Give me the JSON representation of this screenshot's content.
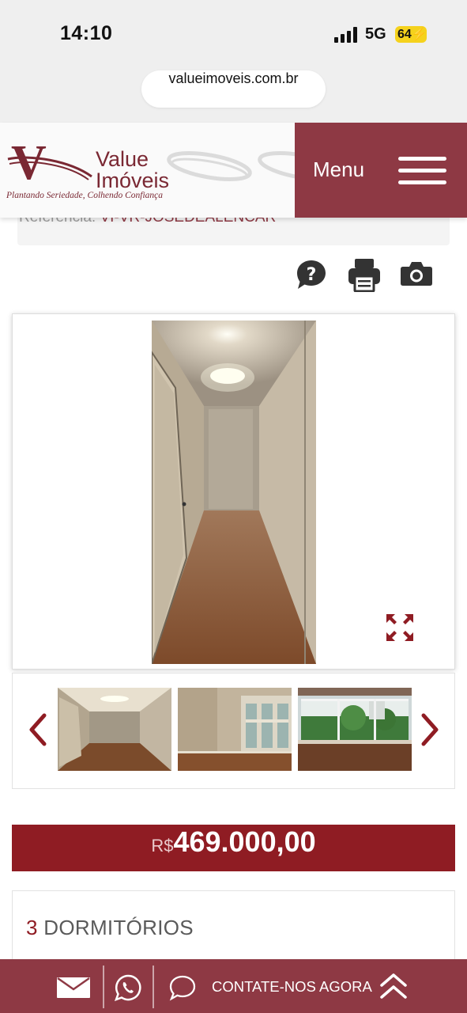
{
  "status_bar": {
    "time": "14:10",
    "network": "5G",
    "battery": "64"
  },
  "browser": {
    "url": "valueimoveis.com.br"
  },
  "header": {
    "logo_value": "Value",
    "logo_imoveis": "Imóveis",
    "logo_tagline": "Plantando Seriedade, Colhendo Confiança",
    "menu_label": "Menu"
  },
  "reference": {
    "label": "Referência:",
    "value": "VI-VR-JOSEDEALENCAR"
  },
  "tools": [
    "question-icon",
    "print-icon",
    "camera-icon"
  ],
  "gallery": {
    "main_photo": "hallway-photo",
    "thumbnails": [
      "hallway-thumb",
      "living-room-thumb",
      "window-view-thumb"
    ]
  },
  "price": {
    "currency": "R$",
    "value": "469.000,00"
  },
  "features": {
    "bedrooms_count": "3",
    "bedrooms_label": "DORMITÓRIOS"
  },
  "bottom_bar": {
    "contact_label": "CONTATE-NOS AGORA"
  },
  "colors": {
    "brand": "#8e3944",
    "price_bg": "#8f1c23"
  }
}
